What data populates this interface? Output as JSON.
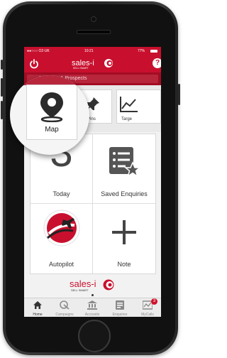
{
  "status": {
    "carrier": "●●○○○ O2-UK",
    "time": "10:21",
    "battery": "77%"
  },
  "header": {
    "logo": "sales-i",
    "logo_tagline": "SELL SMART",
    "help": "?"
  },
  "search": {
    "placeholder": "Accounts & Prospects",
    "full_placeholder": "Accounts & Prospects"
  },
  "shortcuts": [
    {
      "label": "Map",
      "icon": "map-pin-icon"
    },
    {
      "label": "Pins",
      "icon": "pushpin-icon"
    },
    {
      "label": "Targets",
      "icon": "line-graph-icon",
      "visible_label": "Targe"
    }
  ],
  "dashboard": {
    "today": {
      "value": "3",
      "label": "Today"
    },
    "saved": {
      "label": "Saved Enquiries",
      "icon": "list-star-icon"
    },
    "autopilot": {
      "label": "Autopilot",
      "icon": "airplane-logo-icon"
    },
    "note": {
      "label": "Note",
      "icon": "plus-icon"
    }
  },
  "footer_logo": {
    "text": "sales-i",
    "tagline": "SELL SMART"
  },
  "tabs": [
    {
      "label": "Home",
      "icon": "home-icon",
      "active": true
    },
    {
      "label": "Campaigns",
      "icon": "campaigns-icon"
    },
    {
      "label": "Accounts",
      "icon": "bank-icon"
    },
    {
      "label": "Enquiries",
      "icon": "enquiries-icon"
    },
    {
      "label": "MyCalls",
      "icon": "calls-icon",
      "badge": "3"
    }
  ],
  "colors": {
    "brand_red": "#c8102e",
    "tab_bg": "#ececec"
  }
}
